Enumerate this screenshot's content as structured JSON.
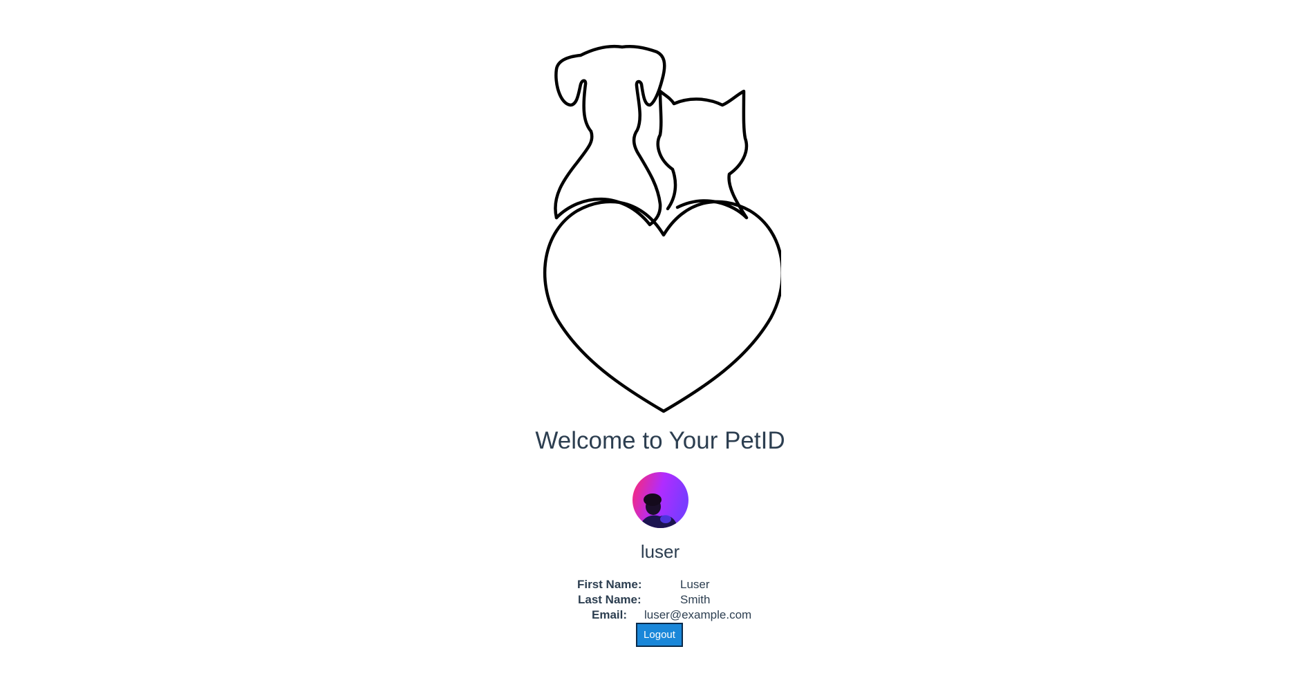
{
  "page": {
    "welcome_title": "Welcome to Your PetID",
    "username": "luser",
    "logout_label": "Logout"
  },
  "profile": {
    "first_name_label": "First Name:",
    "first_name_value": "Luser",
    "last_name_label": "Last Name:",
    "last_name_value": "Smith",
    "email_label": "Email:",
    "email_value": "luser@example.com"
  },
  "icons": {
    "logo": "pet-heart-logo-icon",
    "avatar": "user-avatar-photo"
  },
  "colors": {
    "text": "#2c3e50",
    "button": "#1a87d9",
    "button_border": "#0a2a4a",
    "avatar_gradient_start": "#ff2a6d",
    "avatar_gradient_end": "#7b3bff"
  }
}
